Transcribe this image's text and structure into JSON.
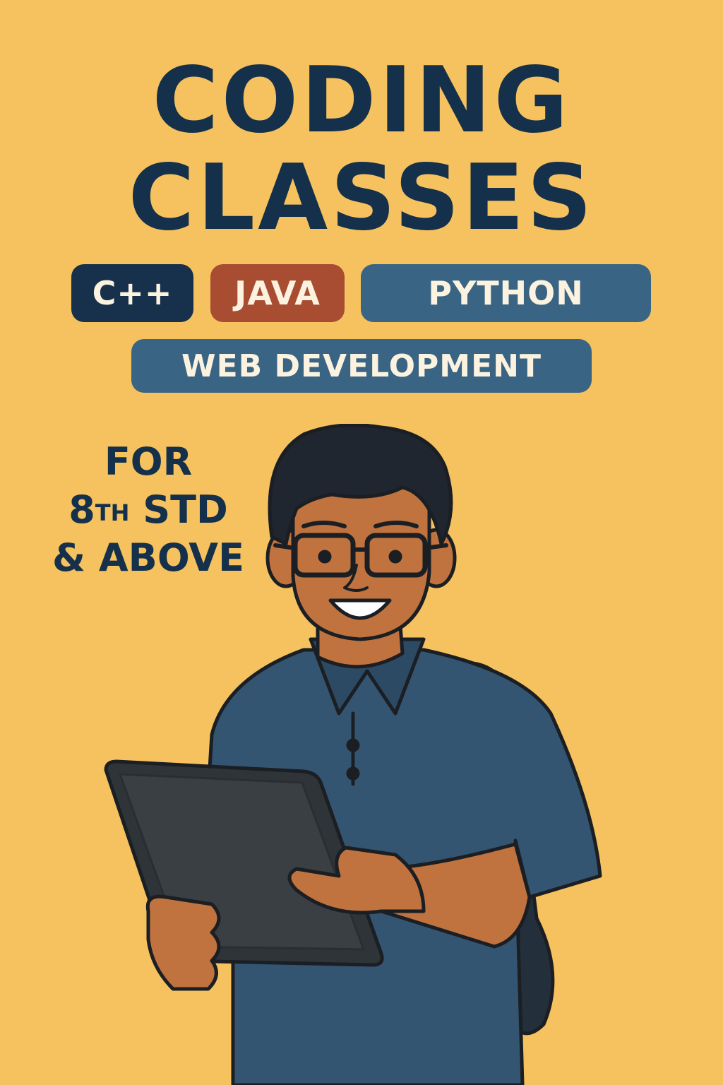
{
  "headline": {
    "line1": "CODING",
    "line2": "CLASSES"
  },
  "courses": [
    "C++",
    "JAVA",
    "PYTHON",
    "WEB DEVELOPMENT"
  ],
  "audience": {
    "line1": "FOR",
    "grade_number": "8",
    "grade_suffix": "TH",
    "grade_word": "STD",
    "line3": "& ABOVE"
  },
  "colors": {
    "background": "#f5c25f",
    "navy": "#17304b",
    "rust": "#a84c32",
    "steel_blue": "#3a6484",
    "skin": "#c0733e",
    "shirt": "#345572"
  }
}
